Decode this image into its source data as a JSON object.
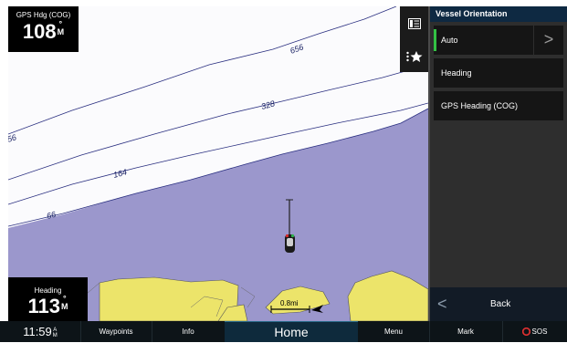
{
  "gauges": {
    "top": {
      "label": "GPS Hdg (COG)",
      "value": "108",
      "unit_deg": "°",
      "unit_ref": "M"
    },
    "bottom": {
      "label": "Heading",
      "value": "113",
      "unit_deg": "°",
      "unit_ref": "M"
    }
  },
  "chart": {
    "contours": [
      "656",
      "328",
      "164",
      "66",
      "56"
    ],
    "scale": {
      "label": "0.8mi"
    },
    "colors": {
      "water": "#9b97cc",
      "land": "#ece46a",
      "chart_bg": "#fbfbfd"
    }
  },
  "toolstrip": {
    "items": [
      "chart-layers-icon",
      "favorites-star-icon"
    ]
  },
  "panel": {
    "title": "Vessel Orientation",
    "options": [
      {
        "label": "Auto",
        "selected": true,
        "has_submenu": true,
        "chevron": ">"
      },
      {
        "label": "Heading",
        "selected": false
      },
      {
        "label": "GPS Heading (COG)",
        "selected": false
      }
    ],
    "back": {
      "arrow": "<",
      "label": "Back"
    }
  },
  "bottombar": {
    "time": "11:59",
    "ampm": [
      "A",
      "M"
    ],
    "buttons": [
      "Waypoints",
      "Info",
      "Home",
      "Menu",
      "Mark",
      "SOS"
    ],
    "accent": "#e03030"
  }
}
